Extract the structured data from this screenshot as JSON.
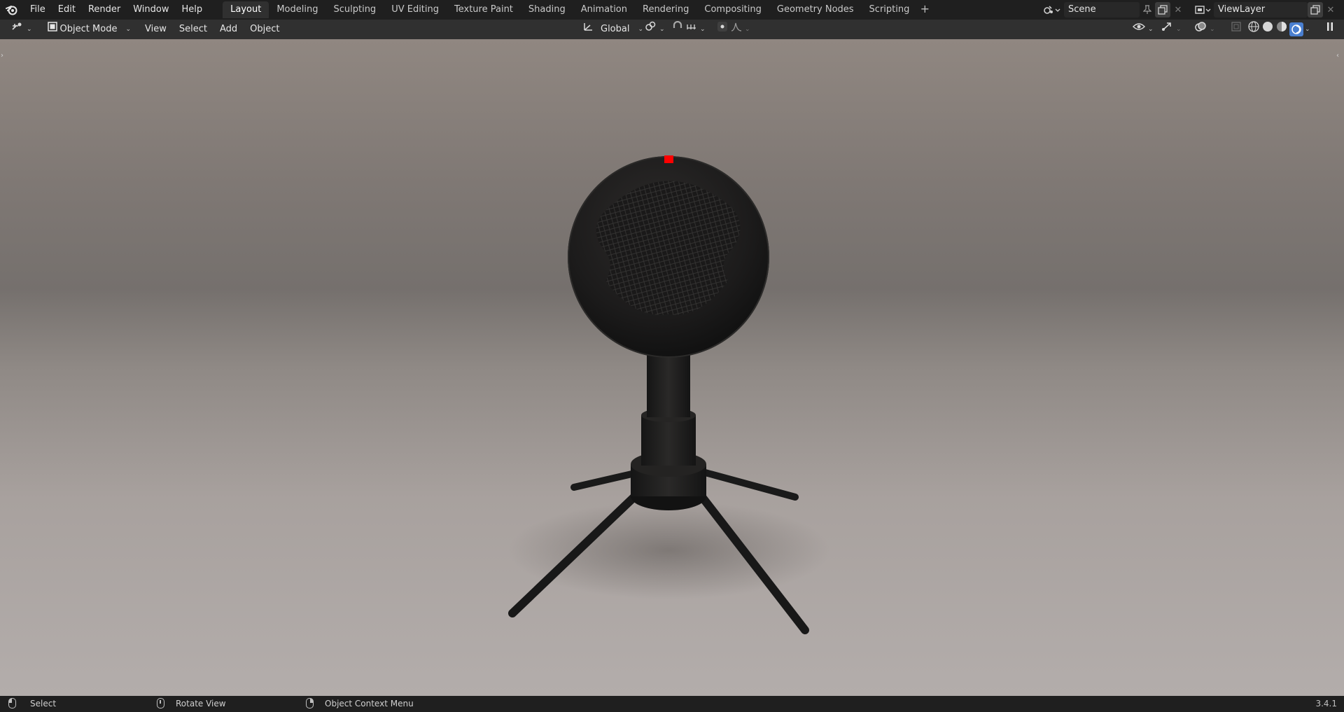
{
  "topbar": {
    "menus": [
      "File",
      "Edit",
      "Render",
      "Window",
      "Help"
    ],
    "workspaces": [
      "Layout",
      "Modeling",
      "Sculpting",
      "UV Editing",
      "Texture Paint",
      "Shading",
      "Animation",
      "Rendering",
      "Compositing",
      "Geometry Nodes",
      "Scripting"
    ],
    "active_workspace": "Layout",
    "scene_name": "Scene",
    "view_layer_name": "ViewLayer"
  },
  "header": {
    "mode": "Object Mode",
    "menus": [
      "View",
      "Select",
      "Add",
      "Object"
    ],
    "transform_orientation": "Global"
  },
  "statusbar": {
    "select": "Select",
    "rotate_view": "Rotate View",
    "context_menu": "Object Context Menu",
    "version": "3.4.1"
  },
  "viewport": {
    "object": "microphone-on-tripod",
    "indicator_color": "#ff0000"
  },
  "colors": {
    "topbar_bg": "#1f1f1f",
    "header_bg": "#303030",
    "active_shading": "#4a7fd0"
  }
}
